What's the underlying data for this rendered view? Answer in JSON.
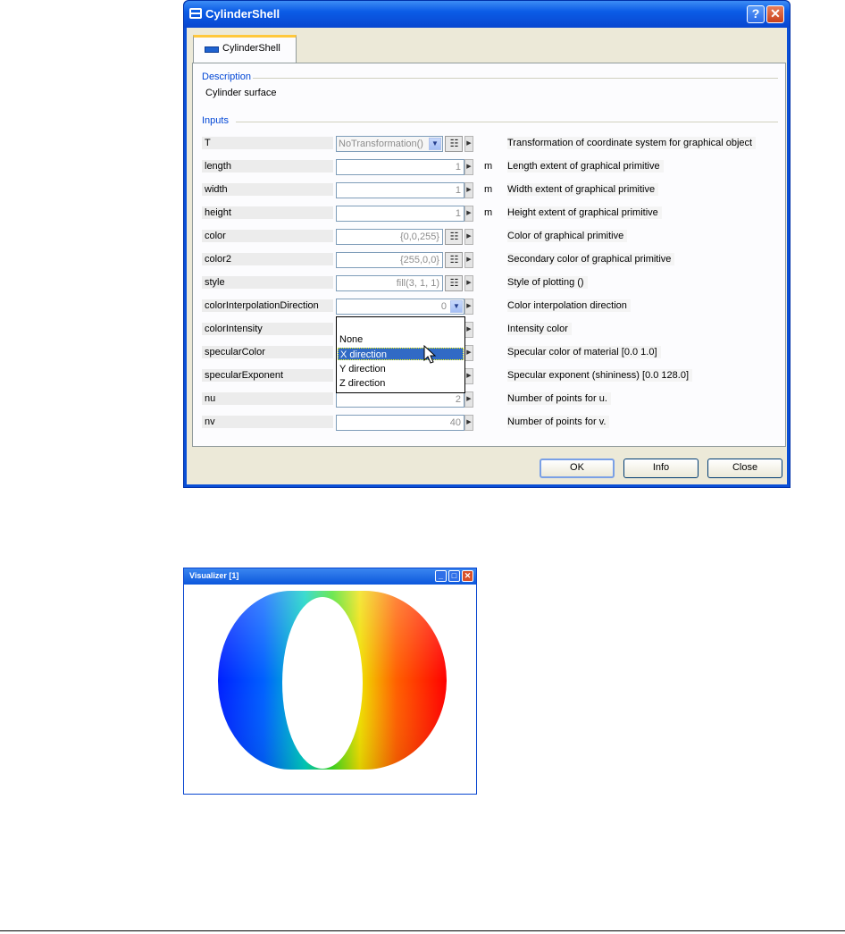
{
  "dialog": {
    "title": "CylinderShell",
    "help_glyph": "?",
    "close_glyph": "✕",
    "tab_label": "CylinderShell",
    "description_heading": "Description",
    "description_text": "Cylinder surface",
    "inputs_heading": "Inputs",
    "rows": [
      {
        "name": "T",
        "value": "NoTransformation()",
        "unit": "",
        "desc": "Transformation of coordinate system for graphical object"
      },
      {
        "name": "length",
        "value": "1",
        "unit": "m",
        "desc": "Length extent of graphical primitive"
      },
      {
        "name": "width",
        "value": "1",
        "unit": "m",
        "desc": "Width extent of graphical primitive"
      },
      {
        "name": "height",
        "value": "1",
        "unit": "m",
        "desc": "Height extent of graphical primitive"
      },
      {
        "name": "color",
        "value": "{0,0,255}",
        "unit": "",
        "desc": "Color of graphical primitive"
      },
      {
        "name": "color2",
        "value": "{255,0,0}",
        "unit": "",
        "desc": "Secondary color of graphical primitive"
      },
      {
        "name": "style",
        "value": "fill(3, 1, 1)",
        "unit": "",
        "desc": "Style of plotting ()"
      },
      {
        "name": "colorInterpolationDirection",
        "value": "0",
        "unit": "",
        "desc": "Color interpolation direction"
      },
      {
        "name": "colorIntensity",
        "value": "",
        "unit": "",
        "desc": "Intensity color"
      },
      {
        "name": "specularColor",
        "value": "",
        "unit": "",
        "desc": "Specular color of material [0.0 1.0]"
      },
      {
        "name": "specularExponent",
        "value": "",
        "unit": "",
        "desc": "Specular exponent (shininess) [0.0 128.0]"
      },
      {
        "name": "nu",
        "value": "2",
        "unit": "",
        "desc": "Number of points for u."
      },
      {
        "name": "nv",
        "value": "40",
        "unit": "",
        "desc": "Number of points for v."
      }
    ],
    "dropdown_options": [
      "None",
      "X direction",
      "Y direction",
      "Z direction"
    ],
    "dropdown_selected": "X direction",
    "buttons": {
      "ok": "OK",
      "info": "Info",
      "close": "Close"
    }
  },
  "visualizer": {
    "title": "Visualizer  [1]"
  }
}
